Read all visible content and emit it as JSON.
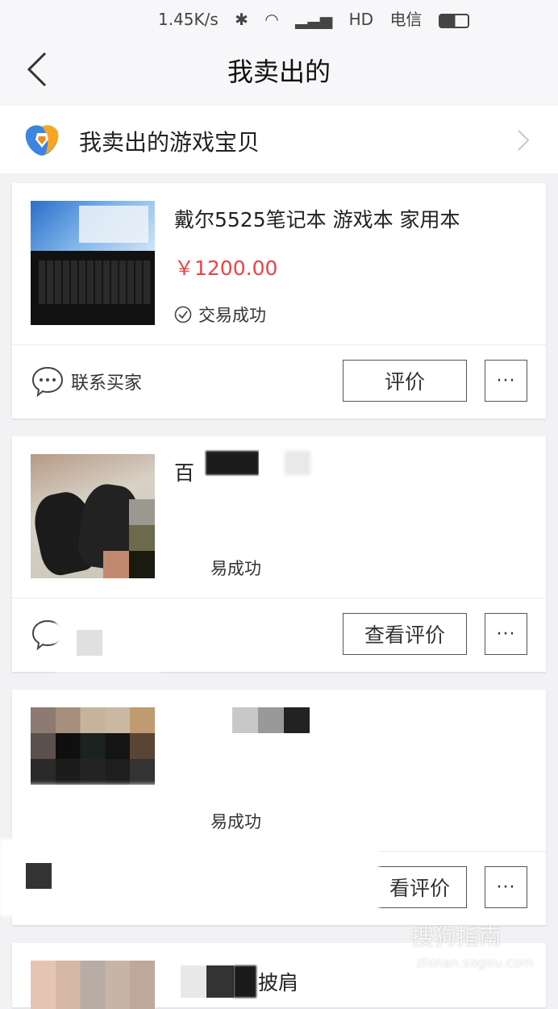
{
  "status_bar": {
    "speed": "1.45K/s",
    "network": "HD",
    "carrier": "电信"
  },
  "nav": {
    "title": "我卖出的"
  },
  "game_row": {
    "label": "我卖出的游戏宝贝"
  },
  "orders": [
    {
      "title": "戴尔5525笔记本 游戏本 家用本",
      "price": "￥1200.00",
      "status": "交易成功",
      "contact_label": "联系买家",
      "action_label": "评价",
      "more_label": "···"
    },
    {
      "title": "百",
      "status": "易成功",
      "contact_label": "买家",
      "action_label": "查看评价",
      "more_label": "···"
    },
    {
      "status": "易成功",
      "action_label": "看评价",
      "more_label": "···"
    },
    {
      "title": "披肩"
    }
  ],
  "watermark": {
    "text": "搜狗指南",
    "url": "zhinan.sogou.com"
  },
  "colors": {
    "price": "#e94444",
    "background": "#f2f2f4"
  }
}
